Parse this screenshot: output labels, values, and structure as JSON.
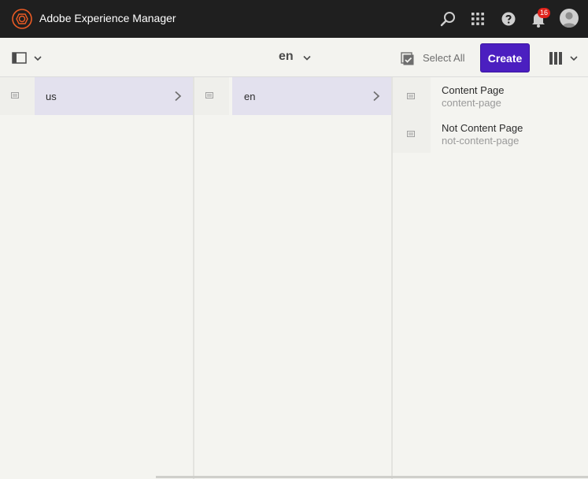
{
  "header": {
    "app_title": "Adobe Experience Manager",
    "notification_count": "16",
    "icons": [
      "search-icon",
      "apps-grid-icon",
      "help-icon",
      "bell-icon",
      "user-avatar"
    ]
  },
  "toolbar": {
    "rail_toggle": "rail-toggle-icon",
    "breadcrumb": "en",
    "select_all_label": "Select All",
    "create_label": "Create",
    "view_switch": "column-view-icon"
  },
  "columns": [
    {
      "items": [
        {
          "label": "us",
          "selected": true,
          "has_children": true
        }
      ]
    },
    {
      "items": [
        {
          "label": "en",
          "selected": true,
          "has_children": true
        }
      ]
    },
    {
      "items": [
        {
          "title": "Content Page",
          "name": "content-page"
        },
        {
          "title": "Not Content Page",
          "name": "not-content-page"
        }
      ]
    }
  ],
  "colors": {
    "topbar": "#1f1f1f",
    "create": "#4b1fc0",
    "selection": "#e3e1ee",
    "badge": "#e0231b",
    "logo": "#eb5b24"
  }
}
